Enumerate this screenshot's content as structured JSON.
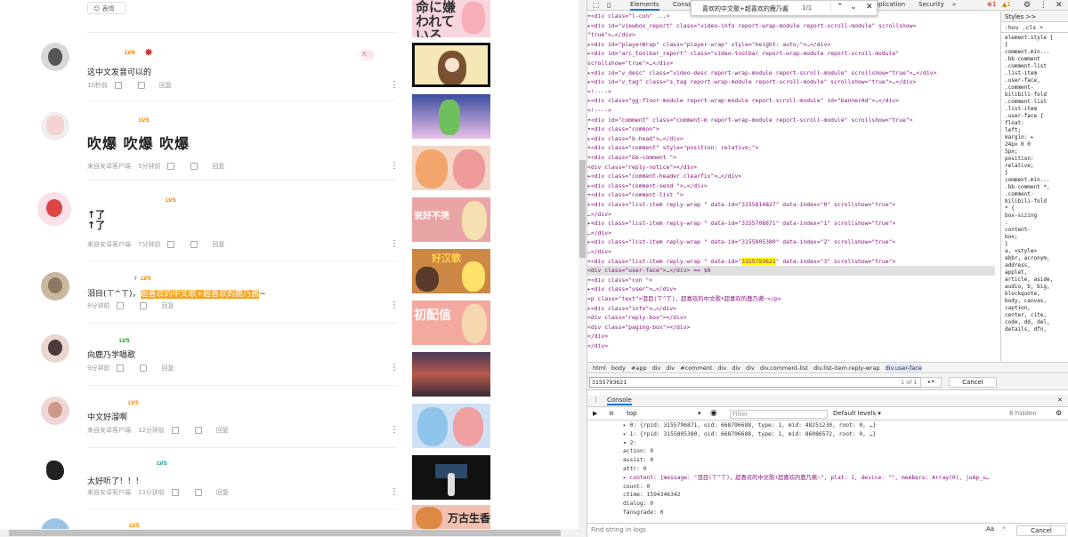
{
  "left": {
    "top_button": "表情",
    "comments": [
      {
        "text": "这中文发音可以的",
        "time": "10秒前",
        "source": "",
        "reply": "回复",
        "level": "LV6",
        "badge": "大"
      },
      {
        "text": "吹爆 吹爆 吹爆",
        "time": "5分钟前",
        "source": "来自安卓客户端",
        "reply": "回复",
        "level": "LV5"
      },
      {
        "text": "↑了\n↑了",
        "time": "7分钟前",
        "source": "来自安卓客户端",
        "reply": "回复",
        "level": "LV5"
      },
      {
        "text_pre": "泪目(ㄒ^ㄒ)，",
        "text_hl": "超喜欢的中文歌+超喜欢的鹿乃酱",
        "text_post": "~",
        "time": "8分钟前",
        "source": "",
        "reply": "回复",
        "uname": "r",
        "level": "LV5"
      },
      {
        "text": "向鹿乃学唱歌",
        "time": "9分钟前",
        "source": "",
        "reply": "回复",
        "level": "LV5"
      },
      {
        "text": "中文好溜啊",
        "time": "12分钟前",
        "source": "来自安卓客户端",
        "reply": "回复",
        "level": "LV5"
      },
      {
        "text": "太好听了！！！",
        "time": "13分钟前",
        "source": "来自安卓客户端",
        "reply": "回复",
        "level": "LV5"
      }
    ],
    "thumbs": [
      {
        "label": "命に嫌われている",
        "color": "#f6d6dc"
      },
      {
        "label": "",
        "color": "#f7c89a"
      },
      {
        "label": "",
        "color": "#e8c8e8"
      },
      {
        "label": "",
        "color": "#f5d5c5"
      },
      {
        "label": "说好不哭",
        "color": "#e9a5a5"
      },
      {
        "label": "好汉歌",
        "color": "#c84"
      },
      {
        "label": "初配信",
        "color": "#f3a9a0"
      },
      {
        "label": "",
        "color": "#a66"
      },
      {
        "label": "",
        "color": "#cfe0f5"
      },
      {
        "label": "",
        "color": "#111"
      },
      {
        "label": "万古生香",
        "color": "#f2c0b0"
      }
    ]
  },
  "devtools": {
    "tabs": [
      "Elements",
      "Console",
      "Application",
      "Security"
    ],
    "find_text": "喜欢的中文歌+超喜欢的鹿乃酱",
    "find_count": "1/1",
    "error_count": "1",
    "warn_count": "1",
    "styles_tabs": [
      "Styles",
      ">>"
    ],
    "styles_filter": ":hov .cls +",
    "styles_lines": [
      "element.style {",
      "}",
      "comment.min...",
      ".bb-comment",
      ".comment-list",
      ".list-item",
      ".user-face,",
      ".comment-",
      "bilibili-fold",
      ".comment-list",
      ".list-item",
      ".user-face {",
      "float:",
      "left;",
      "margin: ▸",
      "24px 0 0",
      "5px;",
      "position:",
      "relative;",
      "}",
      "comment.min...",
      ".bb-comment *,",
      ".comment-",
      "bilibili-fold",
      "* {",
      "box-sizing",
      ":",
      "content-",
      "box;",
      "}",
      "a,    <style>",
      "abbr, acronym,",
      "address,",
      "applet,",
      "article, aside,",
      "audio, b, big,",
      "blockquote,",
      "body, canvas,",
      "caption,",
      "center, cite,",
      "code, dd, del,",
      "details, dfn,"
    ],
    "dom_lines": [
      "▾<div class=\"l-con\" ...>",
      "  ▸<div id=\"viewbox_report\" class=\"video-info report-wrap-module report-scroll-module\" scrollshow=",
      "   \"true\">…</div>",
      "  ▸<div id=\"playerWrap\" class=\"player-wrap\" style=\"height: auto;\">…</div>",
      "  ▸<div id=\"arc_toolbar_report\" class=\"video-toolbar report-wrap-module report-scroll-module\"",
      "   scrollshow=\"true\">…</div>",
      "  ▸<div id=\"v_desc\" class=\"video-desc report-wrap-module report-scroll-module\" scrollshow=\"true\">…</div>",
      "  ▸<div id=\"v_tag\" class=\"s_tag report-wrap-module report-scroll-module\" scrollshow=\"true\">…</div>",
      "   <!---->",
      "  ▸<div class=\"gg-floor-module report-wrap-module report-scroll-module\" id=\"bannerAd\">…</div>",
      "   <!---->",
      "  ▾<div id=\"comment\" class=\"comment-m report-wrap-module report-scroll-module\" scrollshow=\"true\">",
      "    ▾<div class=\"common\">",
      "      ▸<div class=\"b-head\">…</div>",
      "      ▾<div class=\"comment\" style=\"position: relative;\">",
      "        ▾<div class=\"bb-comment \">",
      "           <div class=\"reply-notice\"></div>",
      "          ▸<div class=\"comment-header clearfix\">…</div>",
      "          ▸<div class=\"comment-send \">…</div>",
      "          ▾<div class=\"comment-list \">",
      "            ▸<div class=\"list-item reply-wrap \" data-id=\"3155814827\" data-index=\"0\" scrollshow=\"true\">",
      "             …</div>",
      "            ▸<div class=\"list-item reply-wrap \" data-id=\"3155708871\" data-index=\"1\" scrollshow=\"true\">",
      "             …</div>",
      "            ▸<div class=\"list-item reply-wrap \" data-id=\"3155805380\" data-index=\"2\" scrollshow=\"true\">",
      "             …</div>",
      "            ▾<div class=\"list-item reply-wrap \" data-id=\"3155793621\" data-index=\"3\" scrollshow=\"true\">",
      "              <div class=\"user-face\">…</div> == $0",
      "              ▾<div class=\"con \">",
      "                ▸<div class=\"user\">…</div>",
      "                 <p class=\"text\">泪目(ㄒ^ㄒ)，超喜欢的中文歌+超喜欢的鹿乃酱~</p>",
      "                ▸<div class=\"info\">…</div>",
      "                 <div class=\"reply-box\"></div>",
      "                 <div class=\"paging-box\"></div>",
      "               </div>",
      "             </div>"
    ],
    "crumbs": [
      "html",
      "body",
      "#app",
      "div",
      "div",
      "#comment",
      "div",
      "div",
      "div",
      "div.comment-list",
      "div.list-item.reply-wrap",
      "div.user-face"
    ],
    "search_value": "3155793621",
    "search_count": "1 of 1",
    "cancel": "Cancel",
    "console_label": "Console",
    "console_context": "top",
    "console_filter": "Filter",
    "console_levels": "Default levels ▾",
    "console_hidden": "8 hidden",
    "console_lines": [
      "▸ 0: {rpid: 3155796871, oid: 668796688, type: 1, mid: 48251230, root: 0, …}",
      "▸ 1: {rpid: 3155805380, oid: 668796688, type: 1, mid: 86086572, root: 0, …}",
      "▾ 2:",
      "    action: 0",
      "    assist: 0",
      "    attr: 0",
      "  ▸ content: {message: \"泪目(ㄒ^ㄒ)，超喜欢的中文歌+超喜欢的鹿乃酱~\", plat: 1, device: \"\", members: Array(0), jump_u…",
      "    count: 0",
      "    ctime: 1594346342",
      "    dialog: 0",
      "    fansgrade: 0"
    ],
    "find_logs": "Find string in logs",
    "find_cancel": "Cancel"
  }
}
